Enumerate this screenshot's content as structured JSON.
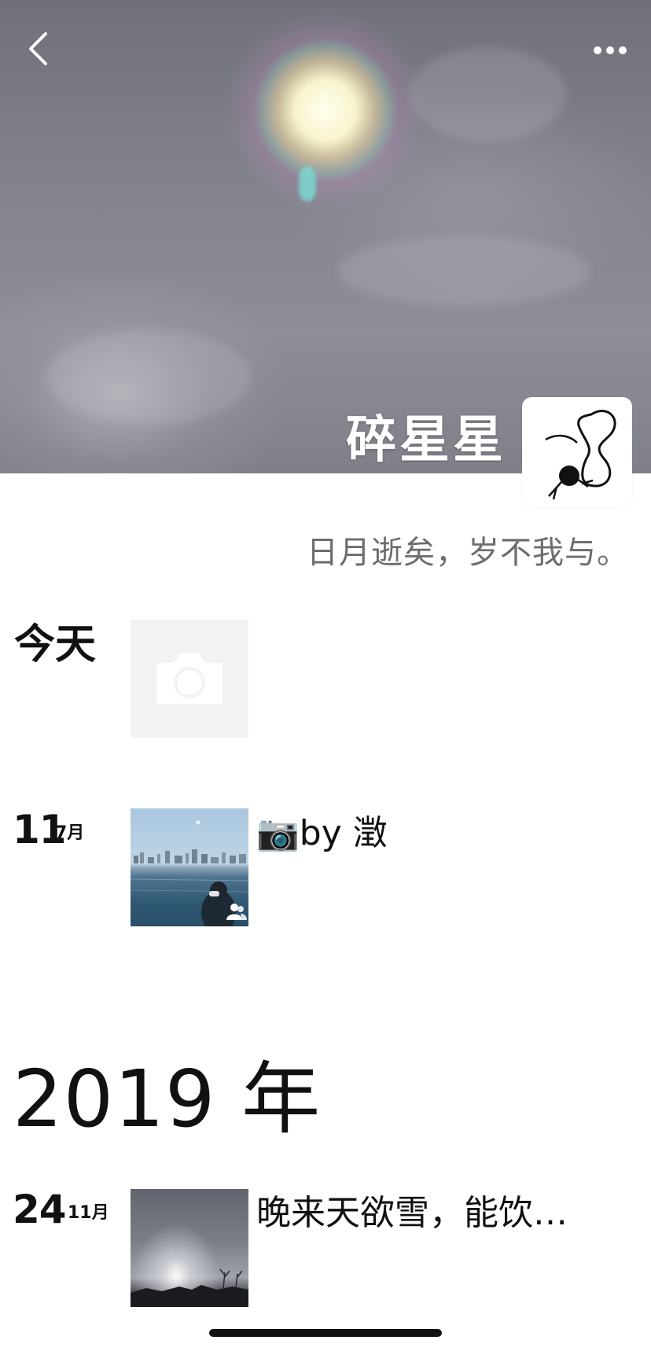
{
  "header": {
    "profile_name": "碎星星",
    "signature": "日月逝矣，岁不我与。"
  },
  "icons": {
    "back": "chevron-left-icon",
    "more": "more-horizontal-icon",
    "camera": "camera-icon",
    "friends": "friends-icon"
  },
  "timeline": {
    "today_label": "今天",
    "posts": [
      {
        "day": "11",
        "month": "7月",
        "text": "📷by 澂"
      },
      {
        "day": "24",
        "month": "11月",
        "text": "晚来天欲雪，能饮…"
      }
    ],
    "year": "2019 年"
  },
  "colors": {
    "background": "#ffffff",
    "text_primary": "#111111",
    "text_secondary": "#6d6d6d",
    "placeholder_tile": "#f2f2f2"
  }
}
